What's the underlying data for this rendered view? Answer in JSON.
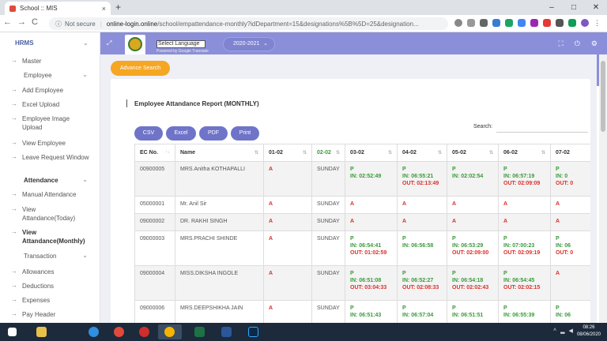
{
  "browser": {
    "tab_title": "School :: MIS",
    "tab_close": "×",
    "new_tab": "+",
    "nav_back": "←",
    "nav_forward": "→",
    "nav_reload": "C",
    "not_secure": "Not secure",
    "domain": "online-login.online",
    "path": "/school/empattendance-monthly?idDepartment=15&designations%5B%5D=25&designation..."
  },
  "sidebar": {
    "title": "HRMS",
    "items": [
      {
        "label": "Master",
        "type": "sub"
      },
      {
        "label": "Employee",
        "type": "group"
      },
      {
        "label": "Add Employee",
        "type": "link"
      },
      {
        "label": "Excel Upload",
        "type": "link"
      },
      {
        "label": "Employee Image Upload",
        "type": "link"
      },
      {
        "label": "View Employee",
        "type": "link"
      },
      {
        "label": "Leave Request Window",
        "type": "link"
      },
      {
        "label": "Attendance",
        "type": "group"
      },
      {
        "label": "Manual Attendance",
        "type": "link"
      },
      {
        "label": "View Attandance(Today)",
        "type": "link"
      },
      {
        "label": "View Attandance(Monthly)",
        "type": "link"
      },
      {
        "label": "Transaction",
        "type": "group"
      },
      {
        "label": "Allowances",
        "type": "link"
      },
      {
        "label": "Deductions",
        "type": "link"
      },
      {
        "label": "Expenses",
        "type": "link"
      },
      {
        "label": "Pay Header",
        "type": "link"
      }
    ]
  },
  "header": {
    "language_select": "Select Language",
    "powered_by": "Powered by Google Translate",
    "session": "2020-2021"
  },
  "advance_search": "Advance Search",
  "report": {
    "title": "Employee Attandance Report (MONTHLY)",
    "buttons": [
      "CSV",
      "Excel",
      "PDF",
      "Print"
    ],
    "search_label": "Search:",
    "columns": [
      "EC No.",
      "Name",
      "01-02",
      "02-02",
      "03-02",
      "04-02",
      "05-02",
      "06-02",
      "07-02"
    ],
    "rows": [
      {
        "ec": "00900005",
        "name": "MRS.Anitha KOTHAPALLI",
        "d01": "A",
        "d02": "SUNDAY",
        "cells": [
          [
            "P",
            "IN: 02:52:49",
            ""
          ],
          [
            "P",
            "IN: 06:55:21",
            "OUT: 02:13:49"
          ],
          [
            "P",
            "IN: 02:02:54",
            ""
          ],
          [
            "P",
            "IN: 06:57:19",
            "OUT: 02:09:09"
          ],
          [
            "P",
            "IN: 0",
            "OUT: 0"
          ]
        ]
      },
      {
        "ec": "05000001",
        "name": "Mr. Anil Sir",
        "d01": "A",
        "d02": "SUNDAY",
        "cells": [
          [
            "A",
            "",
            ""
          ],
          [
            "A",
            "",
            ""
          ],
          [
            "A",
            "",
            ""
          ],
          [
            "A",
            "",
            ""
          ],
          [
            "A",
            "",
            ""
          ]
        ]
      },
      {
        "ec": "09000002",
        "name": "DR. RAKHI SINGH",
        "d01": "A",
        "d02": "SUNDAY",
        "cells": [
          [
            "A",
            "",
            ""
          ],
          [
            "A",
            "",
            ""
          ],
          [
            "A",
            "",
            ""
          ],
          [
            "A",
            "",
            ""
          ],
          [
            "A",
            "",
            ""
          ]
        ]
      },
      {
        "ec": "09000003",
        "name": "MRS.PRACHI SHINDE",
        "d01": "A",
        "d02": "SUNDAY",
        "cells": [
          [
            "P",
            "IN: 06:54:41",
            "OUT: 01:02:59"
          ],
          [
            "P",
            "IN: 06:56:58",
            ""
          ],
          [
            "P",
            "IN: 06:53:29",
            "OUT: 02:09:00"
          ],
          [
            "P",
            "IN: 07:00:23",
            "OUT: 02:09:19"
          ],
          [
            "P",
            "IN: 06",
            "OUT: 0"
          ]
        ]
      },
      {
        "ec": "09000004",
        "name": "MISS.DIKSHA INGOLE",
        "d01": "A",
        "d02": "SUNDAY",
        "cells": [
          [
            "P",
            "IN: 06:51:08",
            "OUT: 03:04:33"
          ],
          [
            "P",
            "IN: 06:52:27",
            "OUT: 02:08:33"
          ],
          [
            "P",
            "IN: 06:54:18",
            "OUT: 02:02:43"
          ],
          [
            "P",
            "IN: 06:54:45",
            "OUT: 02:02:15"
          ],
          [
            "A",
            "",
            ""
          ]
        ]
      },
      {
        "ec": "09000006",
        "name": "MRS.DEEPSHIKHA JAIN",
        "d01": "A",
        "d02": "SUNDAY",
        "cells": [
          [
            "P",
            "IN: 06:51:43",
            ""
          ],
          [
            "P",
            "IN: 06:57:04",
            ""
          ],
          [
            "P",
            "IN: 06:51:51",
            ""
          ],
          [
            "P",
            "IN: 06:55:39",
            ""
          ],
          [
            "P",
            "IN: 06",
            ""
          ]
        ]
      }
    ]
  },
  "taskbar": {
    "time": "08:26",
    "date": "08/06/2020"
  },
  "colors": {
    "header_purple": "#8b8fd9",
    "button_purple": "#6f74c8",
    "advance_orange": "#f5a623",
    "absent_red": "#d9312b",
    "present_green": "#3a9a3a"
  }
}
